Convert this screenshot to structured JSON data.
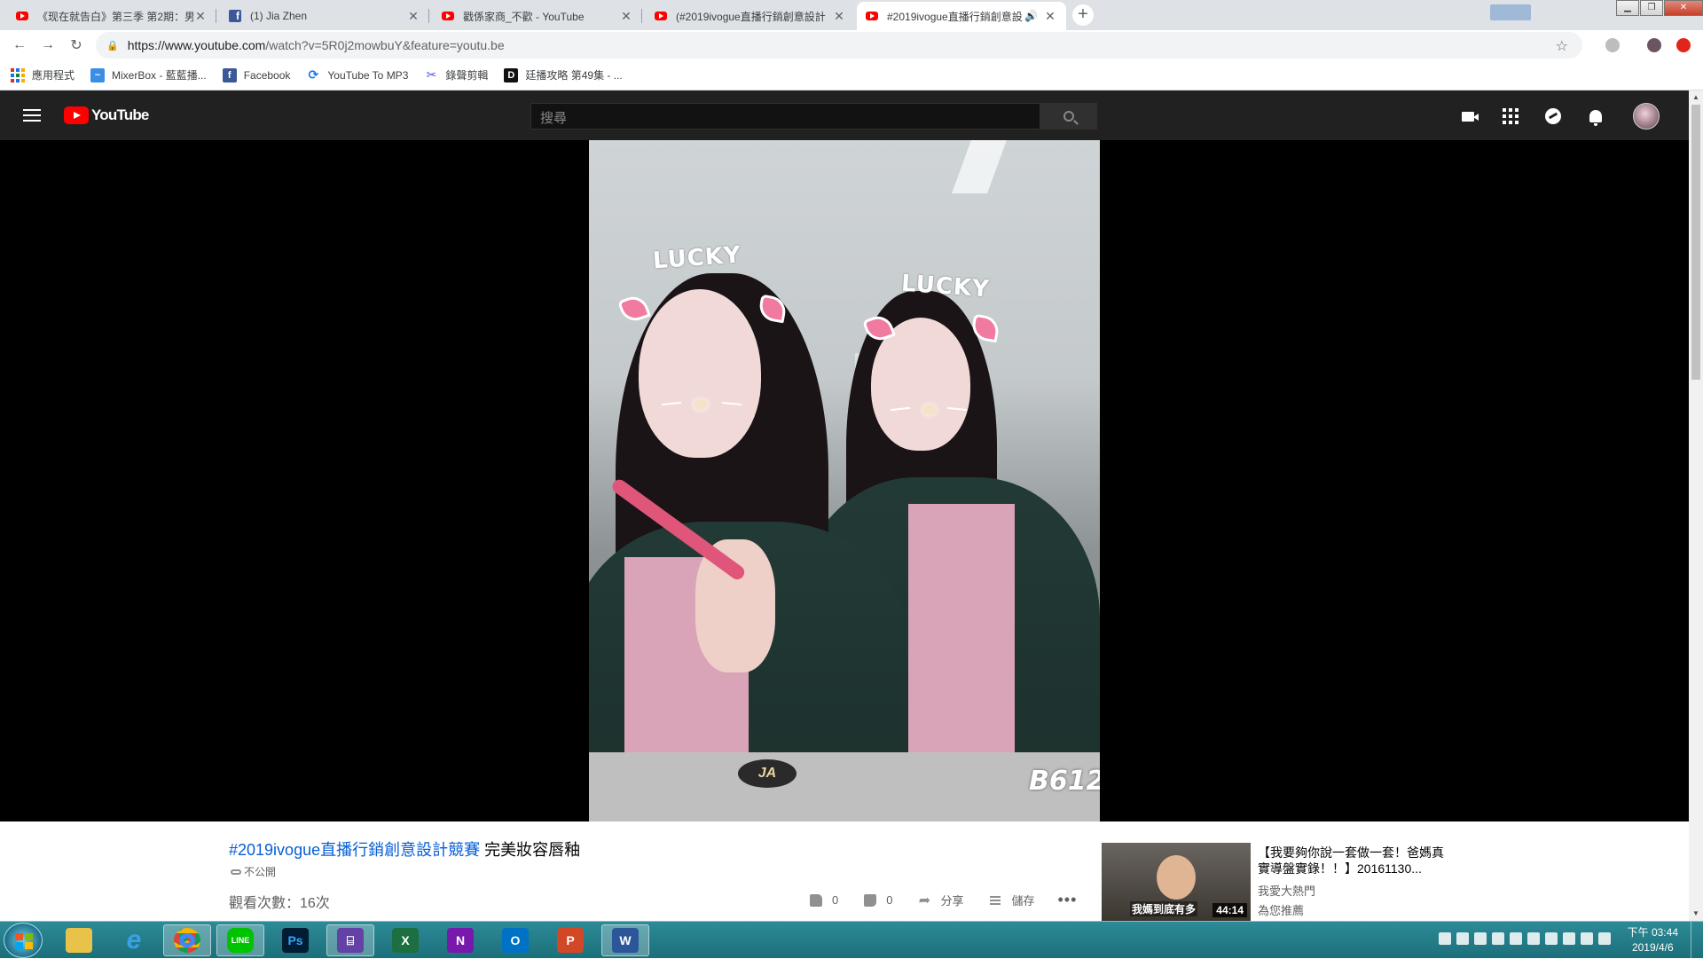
{
  "browser": {
    "tabs": [
      {
        "title": "《现在就告白》第三季 第2期：男",
        "favicon": "youtube-icon",
        "active": false
      },
      {
        "title": "(1) Jia Zhen",
        "favicon": "facebook-icon",
        "active": false
      },
      {
        "title": "戳係家商_不歡 - YouTube",
        "favicon": "youtube-icon",
        "active": false
      },
      {
        "title": "(#2019ivogue直播行銷創意設計",
        "favicon": "youtube-icon",
        "active": false
      },
      {
        "title": "#2019ivogue直播行銷創意設",
        "favicon": "youtube-icon",
        "active": true
      }
    ],
    "new_tab_label": "+",
    "url_host": "https://www.youtube.com",
    "url_path": "/watch?v=5R0j2mowbuY&feature=youtu.be",
    "bookmarks": [
      {
        "label": "應用程式",
        "icon": "apps-icon"
      },
      {
        "label": "MixerBox - 藍藍播...",
        "icon": "mixerbox-icon"
      },
      {
        "label": "Facebook",
        "icon": "facebook-icon"
      },
      {
        "label": "YouTube To MP3",
        "icon": "ytmp3-icon"
      },
      {
        "label": "錄聲剪輯",
        "icon": "audio-cutter-icon"
      },
      {
        "label": "廷播攻略 第49集 - ...",
        "icon": "d-icon"
      }
    ]
  },
  "youtube": {
    "logo_text": "YouTube",
    "search_placeholder": "搜尋",
    "video": {
      "overlay_text_left": "LUCKY",
      "overlay_text_right": "LUCKY",
      "watermark": "B612",
      "table_label": "JA"
    },
    "title_hashtag": "#2019ivogue直播行銷創意設計競賽",
    "title_rest": " 完美妝容唇釉",
    "privacy": "不公開",
    "views": "觀看次數：16次",
    "likes": "0",
    "dislikes": "0",
    "share_label": "分享",
    "save_label": "儲存",
    "more_label": "•••",
    "recommendation": {
      "title": "【我要夠你說一套做一套！爸媽真實導盤實錄！！】20161130...",
      "channel": "我愛大熱門",
      "reason": "為您推薦",
      "duration": "44:14",
      "thumb_caption": "我媽到底有多"
    }
  },
  "taskbar": {
    "apps": [
      {
        "name": "file-explorer",
        "label": ""
      },
      {
        "name": "internet-explorer",
        "label": "e"
      },
      {
        "name": "chrome",
        "label": ""
      },
      {
        "name": "line",
        "label": "LINE"
      },
      {
        "name": "photoshop",
        "label": "Ps"
      },
      {
        "name": "twitch",
        "label": ""
      },
      {
        "name": "excel",
        "label": "X"
      },
      {
        "name": "onenote",
        "label": "N"
      },
      {
        "name": "outlook",
        "label": "O"
      },
      {
        "name": "powerpoint",
        "label": "P"
      },
      {
        "name": "word",
        "label": "W"
      }
    ],
    "time": "下午 03:44",
    "date": "2019/4/6"
  }
}
